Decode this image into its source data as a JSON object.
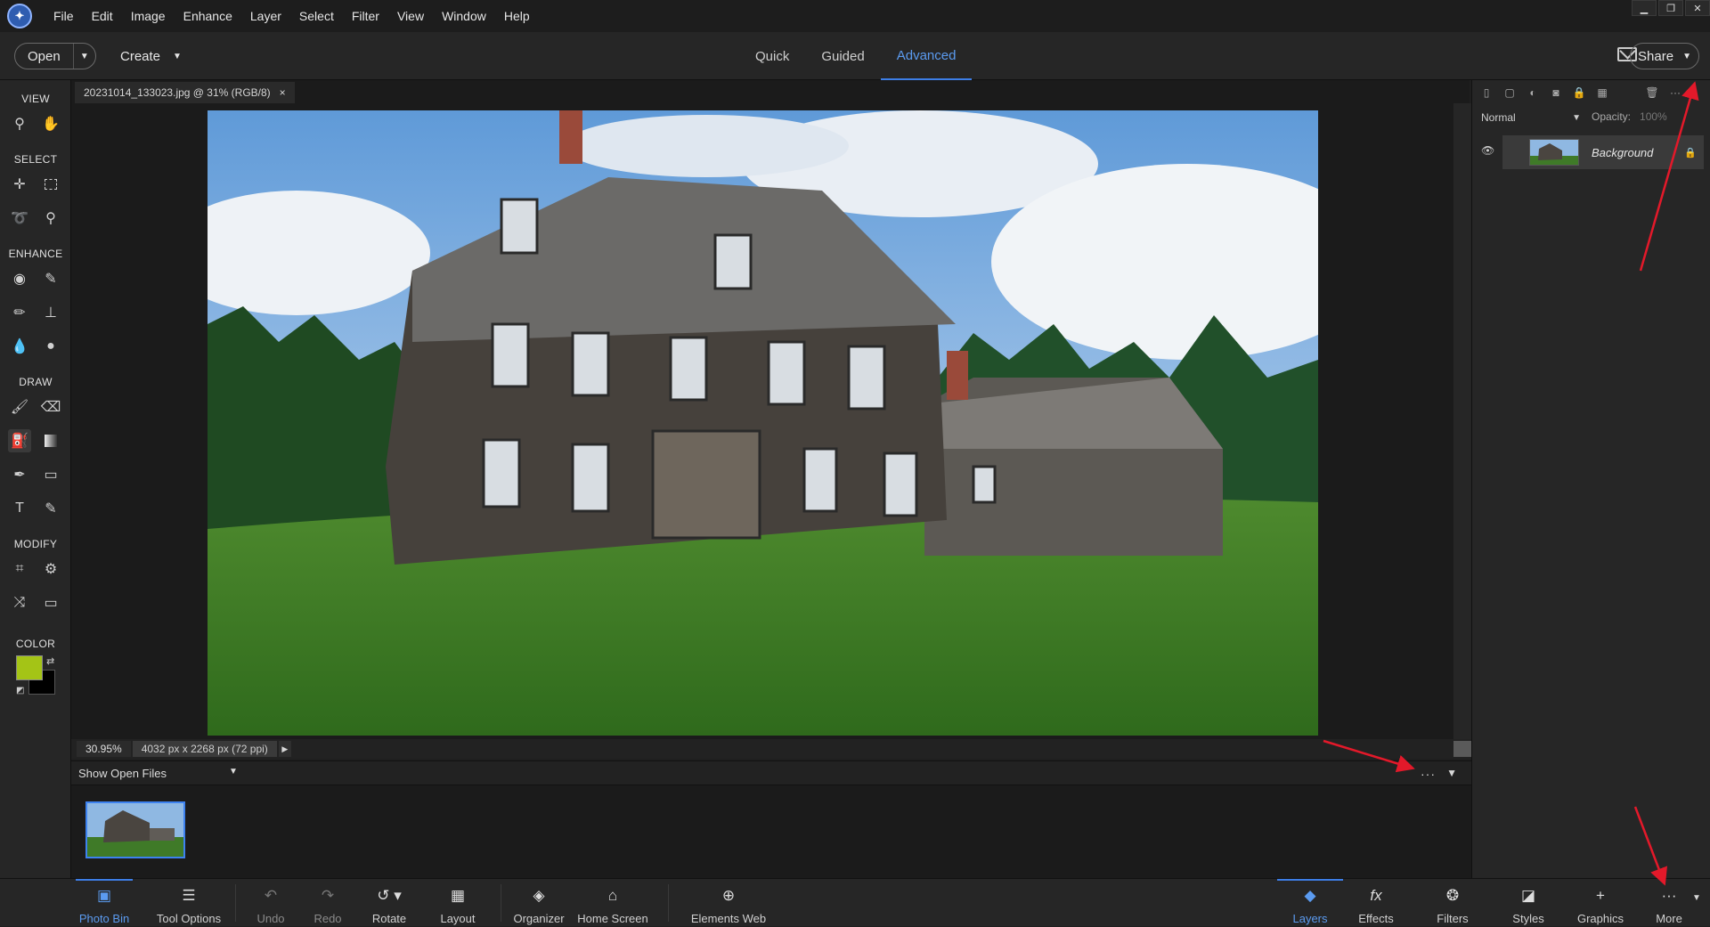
{
  "menubar": {
    "logo_glyph": "✦",
    "menus": [
      "File",
      "Edit",
      "Image",
      "Enhance",
      "Layer",
      "Select",
      "Filter",
      "View",
      "Window",
      "Help"
    ]
  },
  "modebar": {
    "open_label": "Open",
    "create_label": "Create",
    "tabs": [
      "Quick",
      "Guided",
      "Advanced"
    ],
    "active_tab": "Advanced",
    "share_label": "Share"
  },
  "toolbox": {
    "sections": [
      "VIEW",
      "SELECT",
      "ENHANCE",
      "DRAW",
      "MODIFY",
      "COLOR"
    ],
    "foreground_color": "#a4c416",
    "background_color": "#000000"
  },
  "document": {
    "tab_title": "20231014_133023.jpg @ 31% (RGB/8)",
    "close_glyph": "×"
  },
  "status": {
    "zoom": "30.95%",
    "doc_size": "4032 px x 2268 px (72 ppi)"
  },
  "photo_bin": {
    "dropdown_label": "Show Open Files",
    "more_glyph": "···"
  },
  "layers_panel": {
    "blend_mode": "Normal",
    "opacity_label": "Opacity:",
    "opacity_value": "100%",
    "layer_name": "Background"
  },
  "bottom_bar": {
    "left": [
      "Photo Bin",
      "Tool Options",
      "Undo",
      "Redo",
      "Rotate",
      "Layout",
      "Organizer",
      "Home Screen",
      "Elements Web"
    ],
    "right": [
      "Layers",
      "Effects",
      "Filters",
      "Styles",
      "Graphics",
      "More"
    ],
    "active_left": "Photo Bin",
    "active_right": "Layers"
  },
  "colors": {
    "accent": "#3d7ee6",
    "annotation_arrow": "#e3192a"
  }
}
